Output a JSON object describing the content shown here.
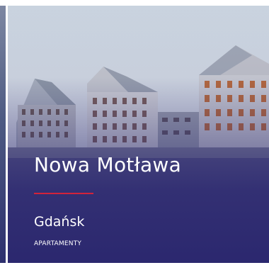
{
  "card": {
    "title": "Nowa Motława",
    "city": "Gdańsk",
    "category": "APARTAMENTY",
    "accent_color": "#d1233b",
    "overlay_color": "#2c2870"
  }
}
